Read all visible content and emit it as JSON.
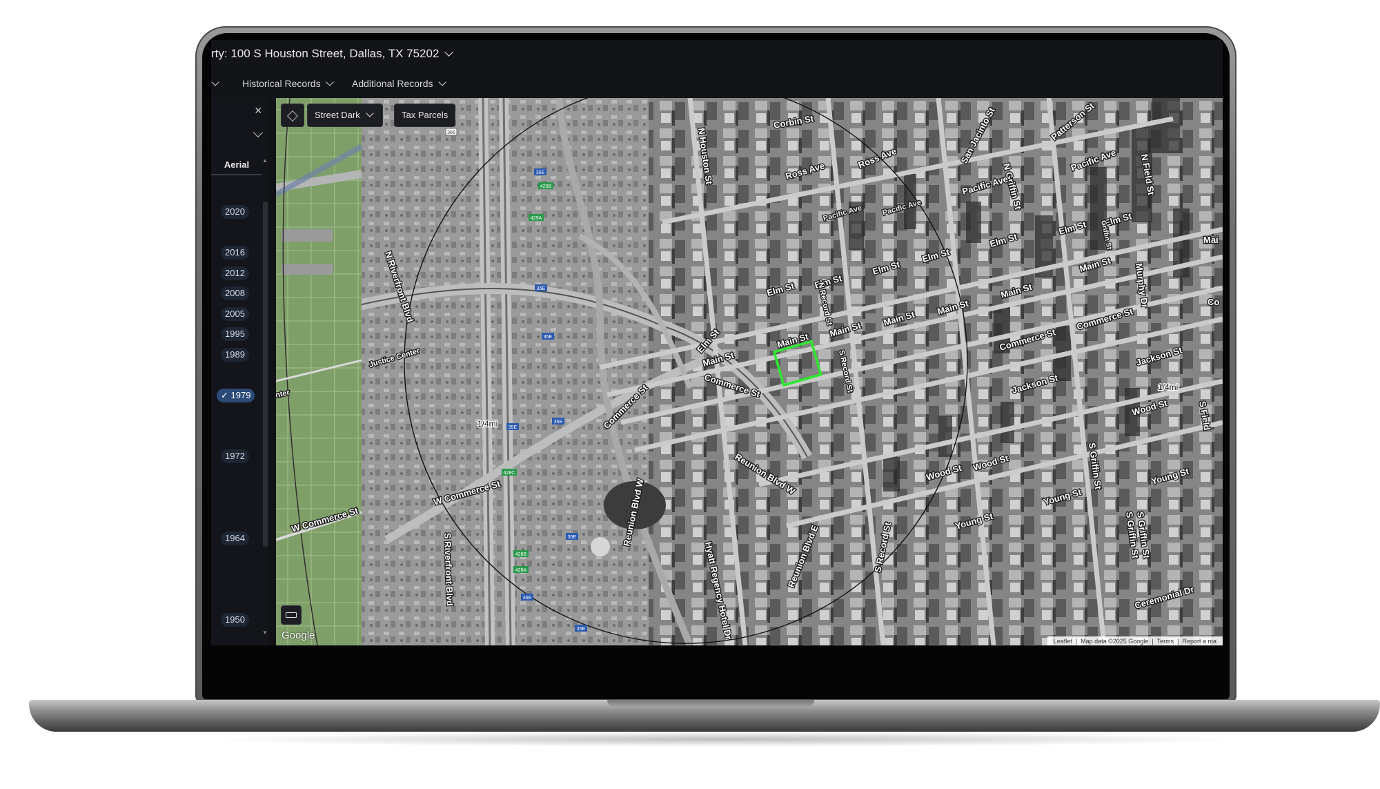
{
  "header": {
    "property_title": "rty: 100 S Houston Street, Dallas, TX 75202"
  },
  "nav": {
    "historical_records": "Historical Records",
    "additional_records": "Additional Records"
  },
  "sidebar": {
    "close": "×",
    "aerial_tab": "Aerial",
    "years": [
      "2020",
      "2016",
      "2012",
      "2008",
      "2005",
      "1995",
      "1989",
      "1979",
      "1972",
      "1964",
      "1950"
    ],
    "selected_year": "✓ 1979"
  },
  "map": {
    "street_dark": "Street Dark",
    "tax_parcels": "Tax Parcels",
    "google": "Google",
    "attribution": {
      "leaflet": "Leaflet",
      "map_data": "Map data ©2025 Google",
      "terms": "Terms",
      "report": "Report a ma"
    },
    "radius_label_left": "1/4mi",
    "radius_label_right": "1/4mi",
    "street_labels": {
      "corbin": "Corbin St",
      "ross_1": "Ross Ave",
      "ross_2": "Ross Ave",
      "san_jacinto": "San Jacinto St",
      "n_griffin": "N Griffin St",
      "patterson": "Patterson St",
      "pacific_1": "Pacific Ave",
      "pacific_2": "Pacific Ave",
      "pacific_3": "Pacific Ave",
      "pacific_4": "Pacific Ave",
      "n_field": "N Field St",
      "elm_1": "Elm St",
      "elm_2": "Elm St",
      "elm_3": "Elm St",
      "elm_4": "Elm St",
      "elm_5": "Elm St",
      "elm_6": "Elm St",
      "elm_7": "Elm St",
      "elm_8": "Elm St",
      "main_1": "Main St",
      "main_2": "Main St",
      "main_3": "Main St",
      "main_4": "Main St",
      "main_5": "Main St",
      "main_6": "Main St",
      "main_7": "Main St",
      "commerce_1": "Commerce St",
      "commerce_2": "Commerce St",
      "commerce_3": "Commerce St",
      "commerce_4": "Commerce St",
      "w_commerce": "W Commerce St",
      "w_commerce_2": "W Commerce St",
      "jackson_1": "Jackson St",
      "jackson_2": "Jackson St",
      "wood_1": "Wood St",
      "wood_2": "Wood St",
      "wood_3": "Wood St",
      "young_1": "Young St",
      "young_2": "Young St",
      "young_3": "Young St",
      "reunion_w": "Reunion Blvd W",
      "reunion_w2": "Reunion Blvd W",
      "reunion_e": "Reunion Blvd E",
      "hyatt": "Hyatt Regency Hotel Dr",
      "n_riverfront": "N Riverfront Blvd",
      "s_riverfront": "S Riverfront Blvd",
      "justice": "Justice Center",
      "enter": "nter",
      "n_houston": "N Houston St",
      "n_record": "N Record St",
      "s_record": "S Record St",
      "s_record2": "S Record St",
      "murphy": "Murphy Dr",
      "s_griffin_1": "S Griffin St",
      "s_griffin_2": "S Griffin St",
      "s_griffin_3": "S Griffin St",
      "ceremonial": "Ceremonial Dr",
      "s_field": "S Field",
      "griffin_mid": "Griffin St",
      "co": "Co",
      "mai": "Mai"
    },
    "shields": [
      "35E",
      "429B",
      "429A",
      "35E",
      "35E",
      "35E",
      "35E",
      "428C",
      "35E",
      "428B",
      "428A",
      "35E",
      "35E",
      "366"
    ]
  },
  "colors": {
    "accent_selected": "#2b4a78",
    "parcel_highlight": "#2ee82e",
    "street_map_green": "#8fae79"
  }
}
